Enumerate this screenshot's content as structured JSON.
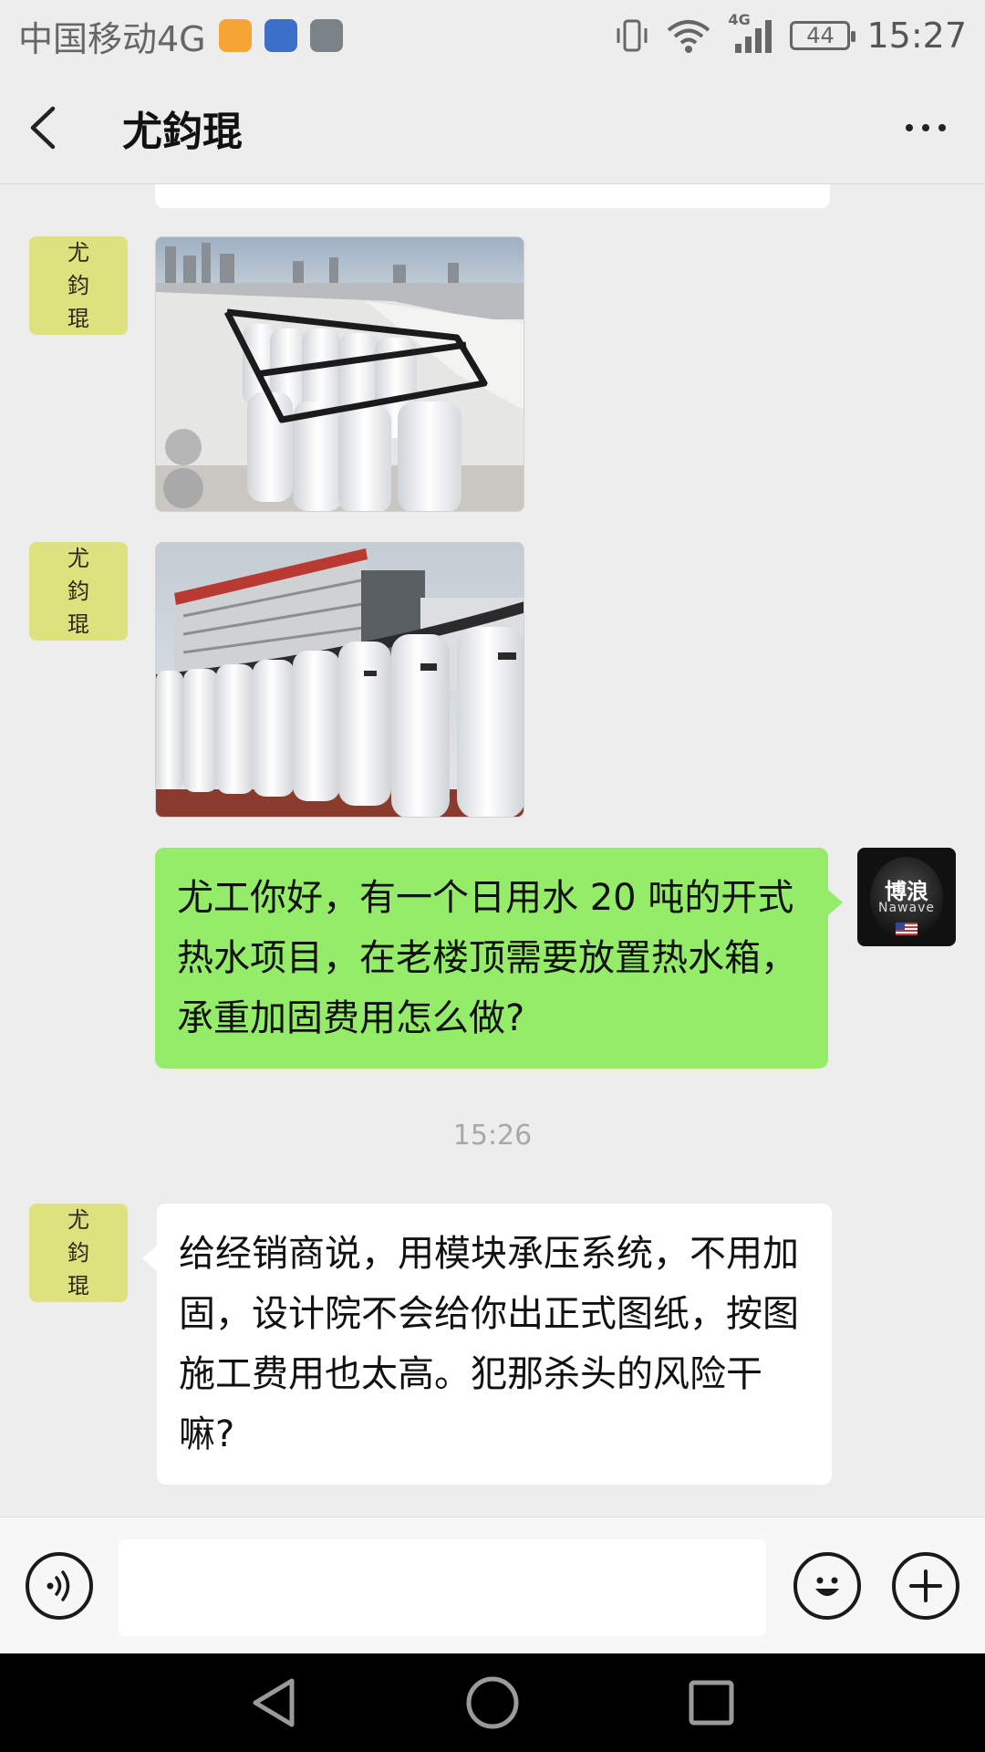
{
  "status_bar": {
    "carrier": "中国移动4G",
    "network": "4G",
    "battery": "44",
    "time": "15:27",
    "app_icons": [
      "health-app-icon",
      "bank-app-icon",
      "shield-app-icon"
    ]
  },
  "header": {
    "title": "尤鈞琨",
    "back_icon": "chevron-left-icon",
    "more_icon": "more-dots-icon"
  },
  "contact_avatar": {
    "chars": [
      "尤",
      "鈞",
      "琨"
    ],
    "color": "#dde27e"
  },
  "my_avatar": {
    "brand_cn": "博浪",
    "brand_en": "Nawave",
    "color": "#111111"
  },
  "messages": [
    {
      "sender": "contact",
      "type": "image",
      "description_icon": "photo-water-tanks-rooftop"
    },
    {
      "sender": "contact",
      "type": "image",
      "description_icon": "photo-water-tanks-building"
    },
    {
      "sender": "me",
      "type": "text",
      "text": "尤工你好，有一个日用水 20 吨的开式热水项目，在老楼顶需要放置热水箱，承重加固费用怎么做?"
    },
    {
      "type": "timestamp",
      "text": "15:26"
    },
    {
      "sender": "contact",
      "type": "text",
      "text": "给经销商说，用模块承压系统，不用加固，设计院不会给你出正式图纸，按图施工费用也太高。犯那杀头的风险干嘛?"
    }
  ],
  "input_bar": {
    "voice_icon": "voice-icon",
    "input_value": "",
    "emoji_icon": "emoji-icon",
    "plus_icon": "plus-icon"
  },
  "nav_bar": {
    "back_icon": "nav-back-icon",
    "home_icon": "nav-home-icon",
    "recents_icon": "nav-recents-icon"
  },
  "colors": {
    "chat_bg": "#ededed",
    "my_bubble": "#95ec69",
    "their_bubble": "#ffffff",
    "timestamp_text": "#a8a8a8"
  }
}
